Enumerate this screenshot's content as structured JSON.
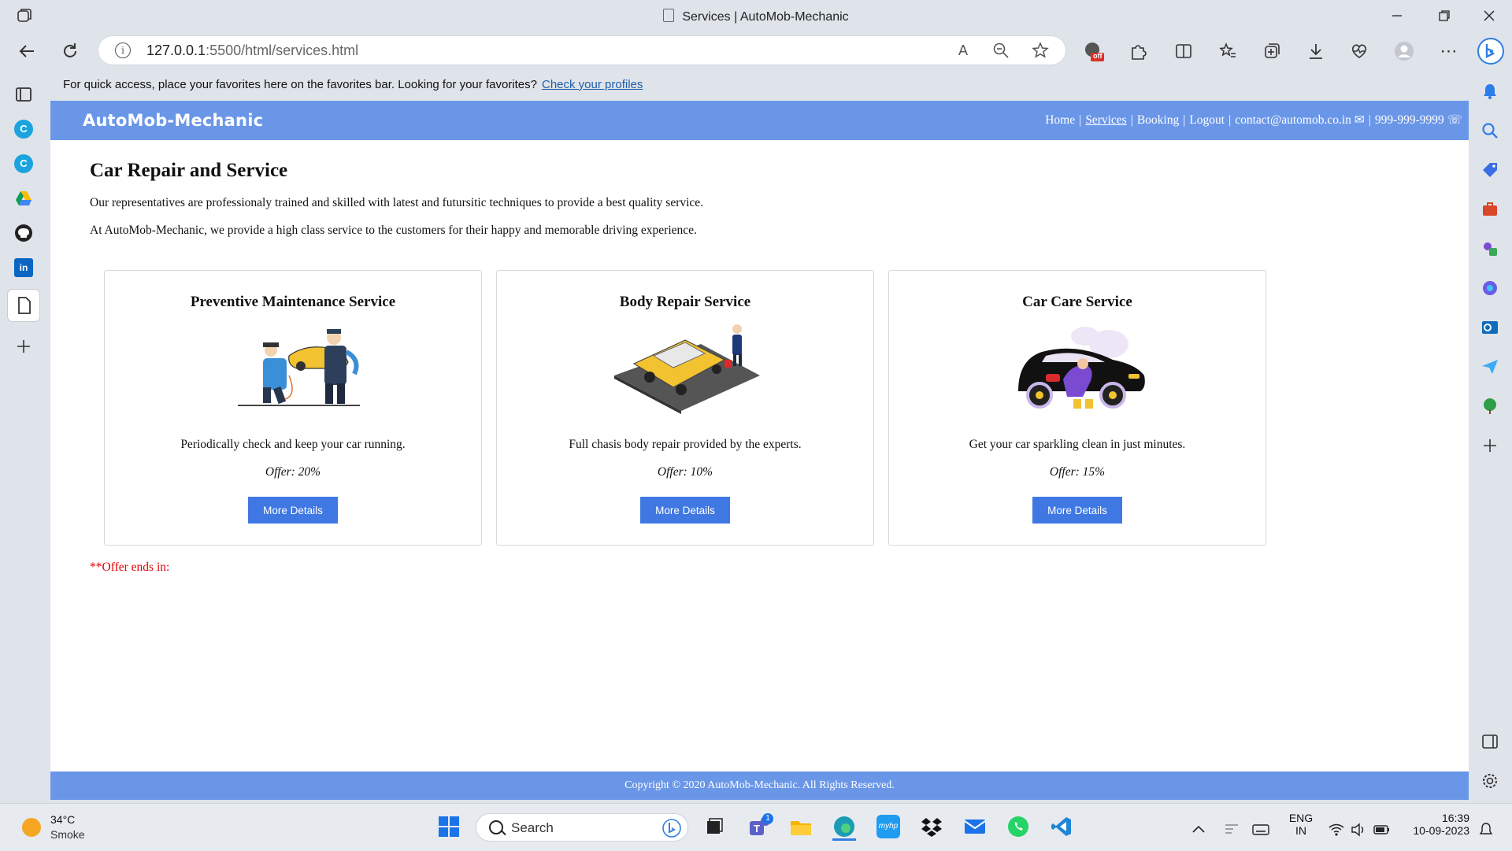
{
  "browser": {
    "window_title": "Services | AutoMob-Mechanic",
    "url_host": "127.0.0.1",
    "url_path": ":5500/html/services.html",
    "read_aloud_label": "A",
    "extension_badge": "off",
    "favorites_bar": {
      "message": "For quick access, place your favorites here on the favorites bar. Looking for your favorites?",
      "link": "Check your profiles"
    }
  },
  "site": {
    "brand": "AutoMob-Mechanic",
    "nav": {
      "home": "Home",
      "services": "Services",
      "booking": "Booking",
      "logout": "Logout",
      "email": "contact@automob.co.in ✉",
      "phone": "999-999-9999 ☏",
      "separator": "|"
    },
    "heading": "Car Repair and Service",
    "paragraph_1": "Our representatives are professionaly trained and skilled with latest and futursitic techniques to provide a best quality service.",
    "paragraph_2": "At AutoMob-Mechanic, we provide a high class service to the customers for their happy and memorable driving experience.",
    "cards": [
      {
        "title": "Preventive Maintenance Service",
        "description": "Periodically check and keep your car running.",
        "offer": "Offer: 20%",
        "button": "More Details"
      },
      {
        "title": "Body Repair Service",
        "description": "Full chasis body repair provided by the experts.",
        "offer": "Offer: 10%",
        "button": "More Details"
      },
      {
        "title": "Car Care Service",
        "description": "Get your car sparkling clean in just minutes.",
        "offer": "Offer: 15%",
        "button": "More Details"
      }
    ],
    "offer_ends": "**Offer ends in:",
    "footer": "Copyright © 2020 AutoMob-Mechanic.  All Rights Reserved.",
    "colors": {
      "header": "#6a96e8",
      "button": "#3f78e3",
      "offer_text": "#e00000"
    }
  },
  "taskbar": {
    "weather_temp": "34°C",
    "weather_condition": "Smoke",
    "search_label": "Search",
    "teams_badge": "1",
    "language": "ENG",
    "region": "IN",
    "time": "16:39",
    "date": "10-09-2023"
  }
}
